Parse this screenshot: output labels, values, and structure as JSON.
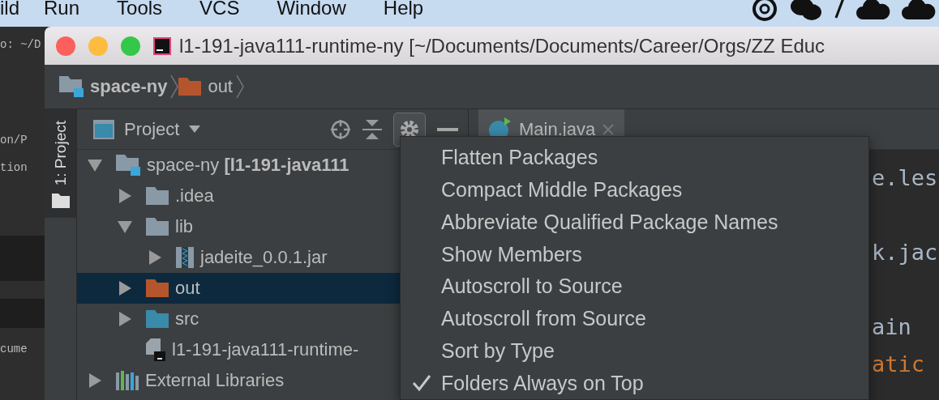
{
  "menu_bar": {
    "items": [
      "ild",
      "Run",
      "Tools",
      "VCS",
      "Window",
      "Help"
    ]
  },
  "terminal": {
    "lines": [
      "o: ~/D",
      "on/P",
      "tion",
      "cume"
    ]
  },
  "window": {
    "title": "l1-191-java111-runtime-ny [~/Documents/Documents/Career/Orgs/ZZ Educ"
  },
  "breadcrumbs": [
    {
      "label": "space-ny",
      "kind": "module"
    },
    {
      "label": "out",
      "kind": "excluded"
    }
  ],
  "tool_strip": {
    "label": "1: Project",
    "selected": true
  },
  "project_panel": {
    "title": "Project",
    "tree": [
      {
        "label": "space-ny **[l1-191-java111**",
        "kind": "module",
        "expanded": true,
        "selected": false,
        "children": [
          {
            "label": ".idea",
            "kind": "folder",
            "expanded": false,
            "selected": false
          },
          {
            "label": "lib",
            "kind": "folder",
            "expanded": true,
            "selected": false,
            "children": [
              {
                "label": "jadeite_0.0.1.jar",
                "kind": "jar",
                "expanded": false,
                "selected": false
              }
            ]
          },
          {
            "label": "out",
            "kind": "excluded",
            "expanded": false,
            "selected": true
          },
          {
            "label": "src",
            "kind": "source",
            "expanded": false,
            "selected": false
          },
          {
            "label": "l1-191-java111-runtime-",
            "kind": "file",
            "selected": false
          }
        ]
      },
      {
        "label": "External Libraries",
        "kind": "libraries",
        "expanded": false,
        "selected": false
      }
    ]
  },
  "editor": {
    "tabs": [
      {
        "label": "Main.java",
        "selected": true
      }
    ],
    "code_lines": [
      {
        "text": "e.les",
        "kind": "plain"
      },
      {
        "text": "k.jac",
        "kind": "plain"
      },
      {
        "text": "ain",
        "kind": "plain"
      },
      {
        "text": "atic",
        "kind": "keyword"
      }
    ]
  },
  "popup_menu": {
    "items": [
      {
        "label": "Flatten Packages",
        "checked": false
      },
      {
        "label": "Compact Middle Packages",
        "checked": false
      },
      {
        "label": "Abbreviate Qualified Package Names",
        "checked": false
      },
      {
        "label": "Show Members",
        "checked": false
      },
      {
        "label": "Autoscroll to Source",
        "checked": false
      },
      {
        "label": "Autoscroll from Source",
        "checked": false
      },
      {
        "label": "Sort by Type",
        "checked": false
      },
      {
        "label": "Folders Always on Top",
        "checked": true
      }
    ]
  }
}
